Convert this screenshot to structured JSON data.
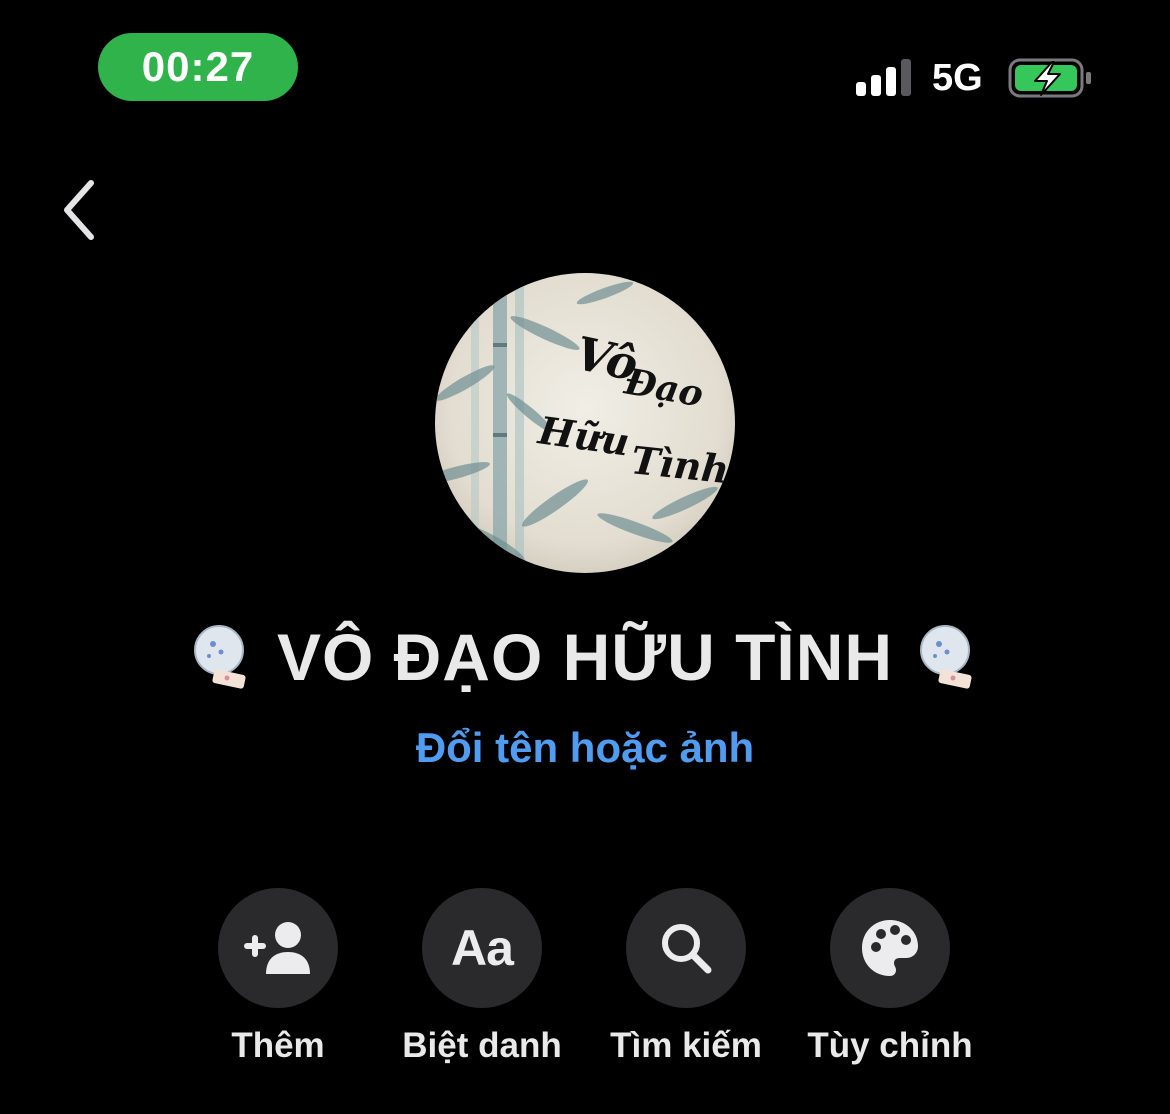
{
  "status_bar": {
    "time": "00:27",
    "network": "5G",
    "time_pill_color": "#30b34a",
    "battery_color": "#35c759"
  },
  "header": {
    "back_icon": "chevron-left-icon"
  },
  "group": {
    "avatar_text": "Vô Đạo Hữu Tình",
    "name": "VÔ ĐẠO HỮU TÌNH",
    "rename_label": "Đổi tên hoặc ảnh",
    "link_color": "#4f9cf0"
  },
  "actions": [
    {
      "label": "Thêm",
      "icon": "add-person-icon"
    },
    {
      "label": "Biệt danh",
      "icon": "text-aa-icon",
      "glyph": "Aa"
    },
    {
      "label": "Tìm kiếm",
      "icon": "search-icon"
    },
    {
      "label": "Tùy chỉnh",
      "icon": "palette-icon"
    }
  ]
}
